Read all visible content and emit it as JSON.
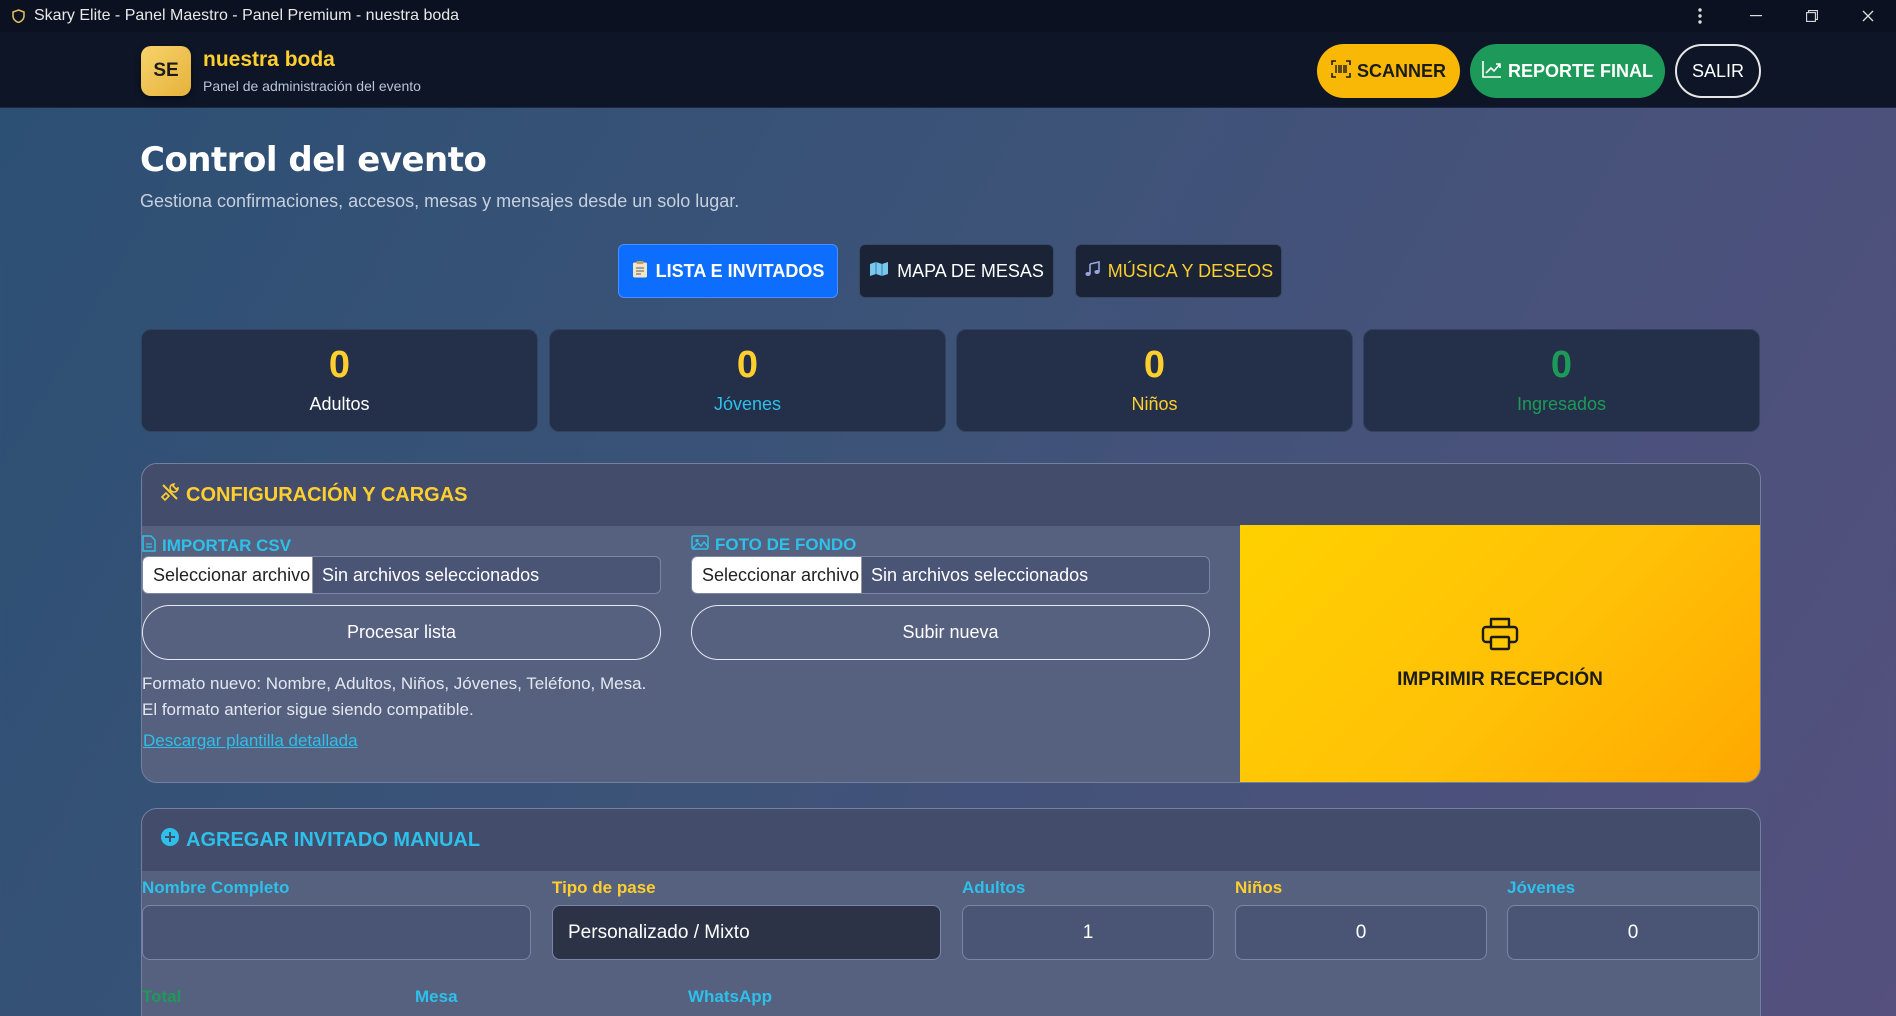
{
  "window": {
    "title": "Skary Elite - Panel Maestro - Panel Premium - nuestra boda",
    "icons": {
      "app": "shield-icon",
      "menu": "more-vertical-icon",
      "minimize": "minimize-icon",
      "restore": "restore-icon",
      "close": "close-icon"
    }
  },
  "header": {
    "logo_text": "SE",
    "title": "nuestra boda",
    "subtitle": "Panel de administración del evento",
    "scanner_label": "SCANNER",
    "report_label": "REPORTE FINAL",
    "exit_label": "SALIR"
  },
  "page": {
    "title": "Control del evento",
    "subtitle": "Gestiona confirmaciones, accesos, mesas y mensajes desde un solo lugar."
  },
  "tabs": [
    {
      "label": "LISTA E INVITADOS",
      "icon": "clipboard-icon",
      "active": true
    },
    {
      "label": "MAPA DE MESAS",
      "icon": "map-icon",
      "active": false
    },
    {
      "label": "MÚSICA Y DESEOS",
      "icon": "music-icon",
      "active": false
    }
  ],
  "stats": [
    {
      "value": "0",
      "label": "Adultos"
    },
    {
      "value": "0",
      "label": "Jóvenes"
    },
    {
      "value": "0",
      "label": "Niños"
    },
    {
      "value": "0",
      "label": "Ingresados"
    }
  ],
  "config": {
    "title": "CONFIGURACIÓN Y CARGAS",
    "csv": {
      "title": "IMPORTAR CSV",
      "file_button": "Seleccionar archivo",
      "file_status": "Sin archivos seleccionados",
      "process_label": "Procesar lista",
      "note_line1": "Formato nuevo: Nombre, Adultos, Niños, Jóvenes, Teléfono, Mesa.",
      "note_line2": "El formato anterior sigue siendo compatible.",
      "template_link": "Descargar plantilla detallada"
    },
    "photo": {
      "title": "FOTO DE FONDO",
      "file_button": "Seleccionar archivo",
      "file_status": "Sin archivos seleccionados",
      "upload_label": "Subir nueva"
    },
    "print_label": "IMPRIMIR RECEPCIÓN"
  },
  "manual": {
    "title": "AGREGAR INVITADO MANUAL",
    "fields": {
      "name_label": "Nombre Completo",
      "name_value": "",
      "pass_label": "Tipo de pase",
      "pass_value": "Personalizado / Mixto",
      "adults_label": "Adultos",
      "adults_value": "1",
      "kids_label": "Niños",
      "kids_value": "0",
      "youth_label": "Jóvenes",
      "youth_value": "0",
      "total_label": "Total",
      "table_label": "Mesa",
      "whatsapp_label": "WhatsApp"
    }
  },
  "colors": {
    "accent_yellow": "#ffcf2e",
    "accent_cyan": "#2dc0ea",
    "accent_green": "#1d9a59",
    "primary_blue": "#0d6efd"
  }
}
